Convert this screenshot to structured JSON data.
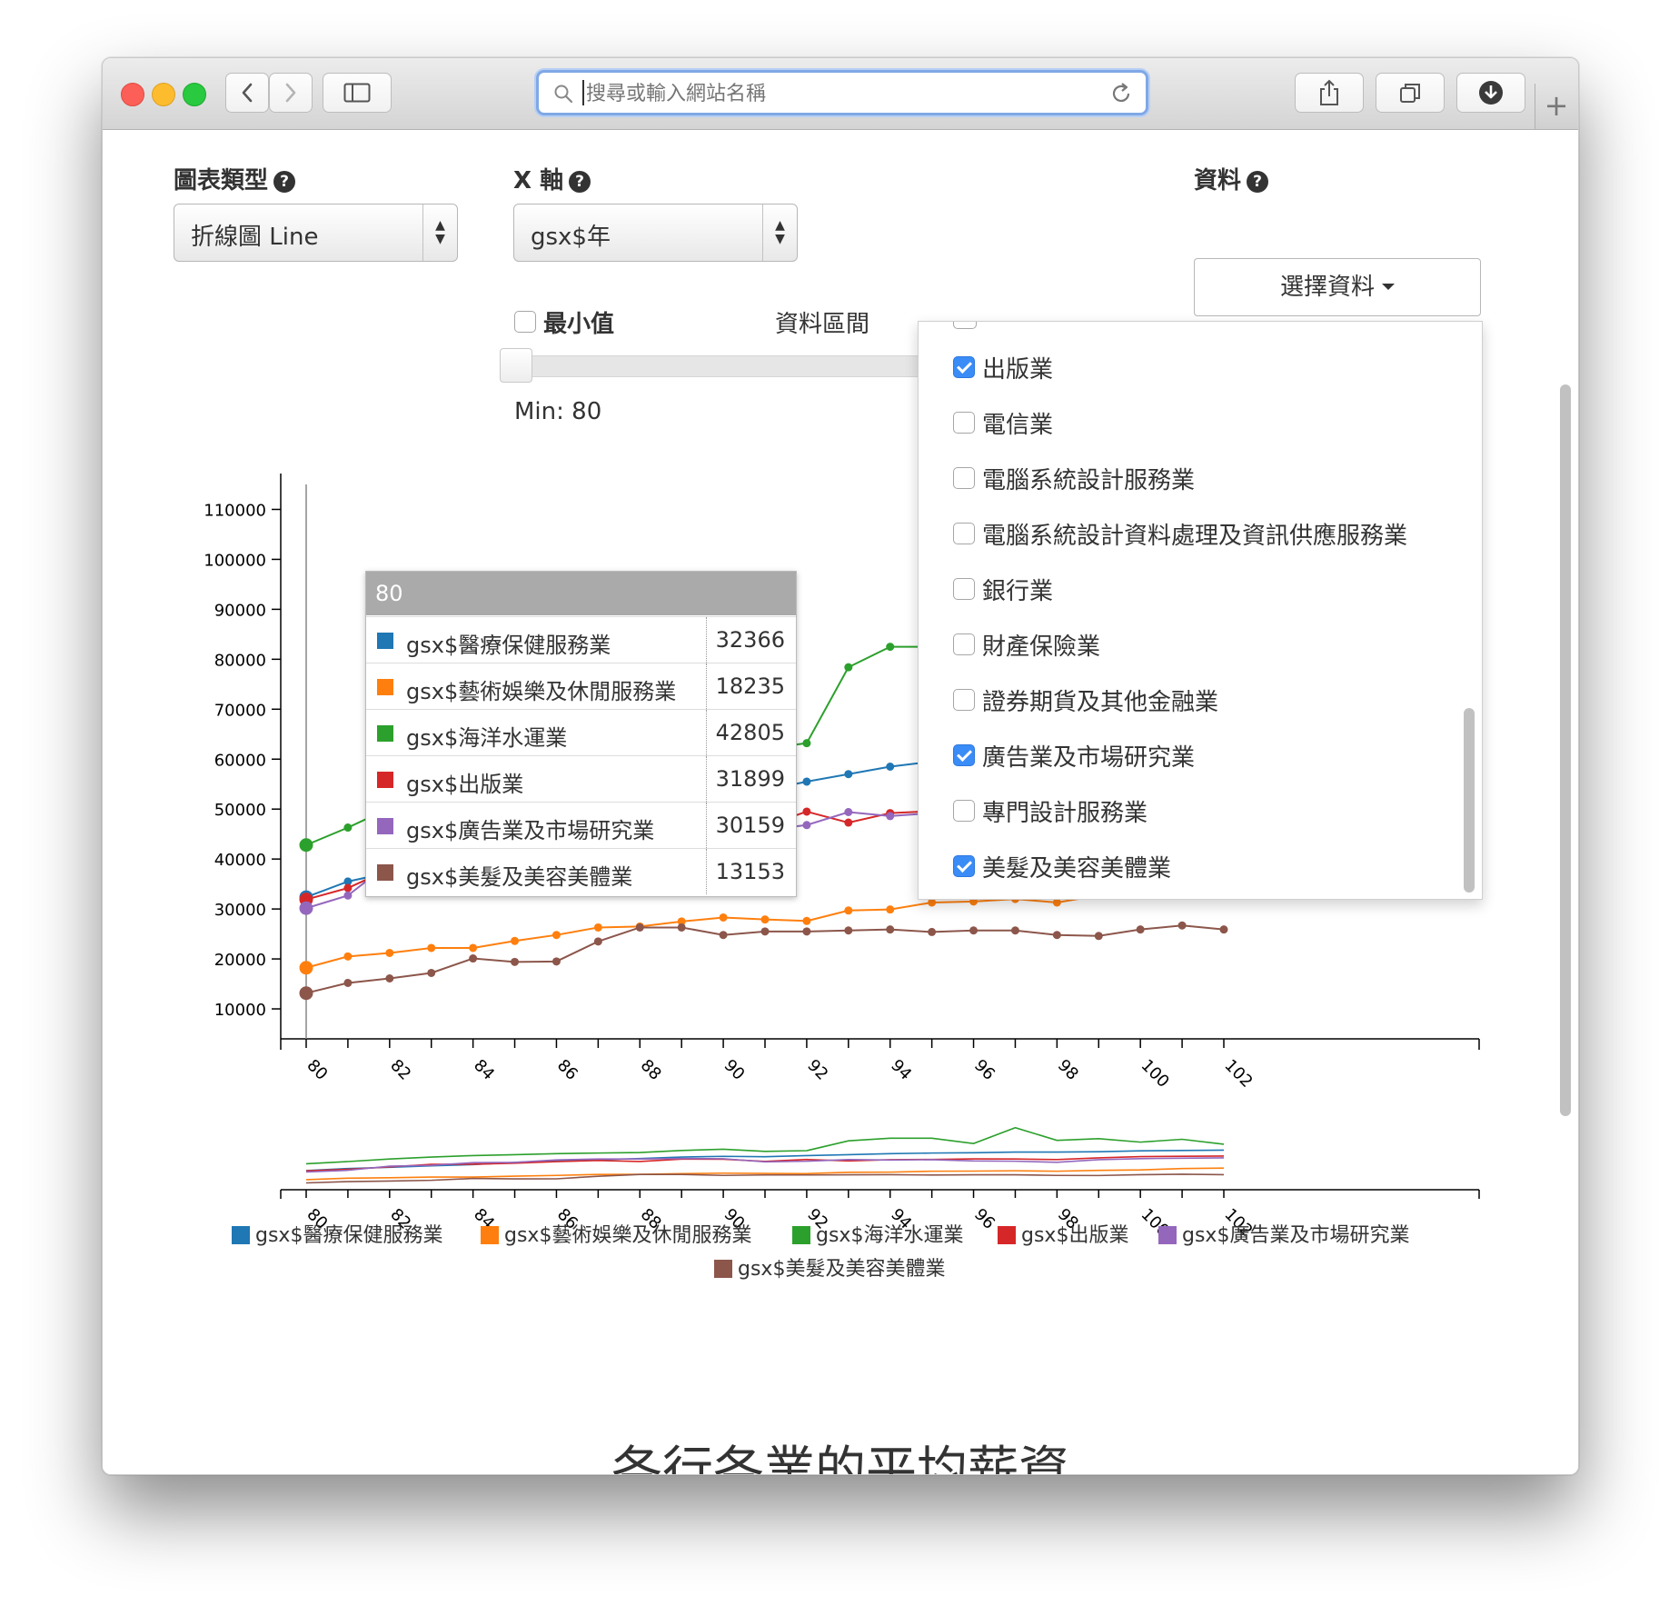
{
  "browser": {
    "address_placeholder": "搜尋或輸入網站名稱",
    "new_tab": "+"
  },
  "controls": {
    "chart_type_label": "圖表類型",
    "chart_type_value": "折線圖 Line",
    "x_axis_label": "X 軸",
    "x_axis_value": "gsx$年",
    "data_label": "資料",
    "data_button": "選擇資料",
    "help_glyph": "?",
    "min_label": "最小值",
    "range_label": "資料區間",
    "min_readout": "Min: 80",
    "select_up": "▲",
    "select_down": "▼"
  },
  "data_menu": {
    "items": [
      {
        "label": "出版業",
        "checked": true
      },
      {
        "label": "電信業",
        "checked": false
      },
      {
        "label": "電腦系統設計服務業",
        "checked": false
      },
      {
        "label": "電腦系統設計資料處理及資訊供應服務業",
        "checked": false
      },
      {
        "label": "銀行業",
        "checked": false
      },
      {
        "label": "財產保險業",
        "checked": false
      },
      {
        "label": "證券期貨及其他金融業",
        "checked": false
      },
      {
        "label": "廣告業及市場研究業",
        "checked": true
      },
      {
        "label": "專門設計服務業",
        "checked": false
      },
      {
        "label": "美髮及美容美體業",
        "checked": true
      }
    ]
  },
  "tooltip": {
    "header": "80",
    "rows": [
      {
        "name": "gsx$醫療保健服務業",
        "value": "32366",
        "color": "#1f77b4"
      },
      {
        "name": "gsx$藝術娛樂及休閒服務業",
        "value": "18235",
        "color": "#ff7f0e"
      },
      {
        "name": "gsx$海洋水運業",
        "value": "42805",
        "color": "#2ca02c"
      },
      {
        "name": "gsx$出版業",
        "value": "31899",
        "color": "#d62728"
      },
      {
        "name": "gsx$廣告業及市場研究業",
        "value": "30159",
        "color": "#9467bd"
      },
      {
        "name": "gsx$美髮及美容美體業",
        "value": "13153",
        "color": "#8c564b"
      }
    ]
  },
  "chart_title": "各行各業的平均薪資",
  "chart_data": {
    "type": "line",
    "title": "各行各業的平均薪資",
    "xlabel": "",
    "ylabel": "",
    "x": [
      80,
      81,
      82,
      83,
      84,
      85,
      86,
      87,
      88,
      89,
      90,
      91,
      92,
      93,
      94,
      95,
      96,
      97,
      98,
      99,
      100,
      101,
      102
    ],
    "x_ticks": [
      80,
      82,
      84,
      86,
      88,
      90,
      92,
      94,
      96,
      98,
      100,
      102
    ],
    "y_ticks": [
      10000,
      20000,
      30000,
      40000,
      50000,
      60000,
      70000,
      80000,
      90000,
      100000,
      110000
    ],
    "ylim": [
      4000,
      115000
    ],
    "grid": false,
    "legend_position": "bottom",
    "series": [
      {
        "name": "gsx$醫療保健服務業",
        "color": "#1f77b4",
        "values": [
          32366,
          35500,
          37300,
          39700,
          41600,
          44900,
          47400,
          49100,
          51000,
          53300,
          54400,
          53800,
          55500,
          57000,
          58500,
          59500,
          60000,
          61000,
          61000,
          61500,
          63000,
          63500,
          64000
        ]
      },
      {
        "name": "gsx$藝術娛樂及休閒服務業",
        "color": "#ff7f0e",
        "values": [
          18235,
          20500,
          21200,
          22200,
          22200,
          23600,
          24800,
          26300,
          26500,
          27500,
          28300,
          27900,
          27600,
          29700,
          29900,
          31300,
          31500,
          32000,
          31300,
          32700,
          33300,
          35400,
          36100
        ]
      },
      {
        "name": "gsx$海洋水運業",
        "color": "#2ca02c",
        "values": [
          42805,
          46300,
          50200,
          53300,
          55600,
          57000,
          58500,
          59500,
          60300,
          63500,
          65400,
          62100,
          63200,
          78400,
          82500,
          82500,
          74300,
          98800,
          79200,
          81800,
          76400,
          80800,
          73100
        ]
      },
      {
        "name": "gsx$出版業",
        "color": "#d62728",
        "values": [
          31899,
          34200,
          38000,
          42000,
          42200,
          43800,
          46100,
          48000,
          46400,
          50100,
          49900,
          46600,
          49500,
          47300,
          49200,
          49600,
          50400,
          50200,
          49400,
          52000,
          54000,
          54500,
          54800
        ]
      },
      {
        "name": "gsx$廣告業及市場研究業",
        "color": "#9467bd",
        "values": [
          30159,
          32700,
          39200,
          40400,
          44600,
          45000,
          48900,
          50300,
          50200,
          51000,
          50700,
          45800,
          46800,
          49400,
          48600,
          49200,
          47200,
          46800,
          45100,
          49200,
          50800,
          51500,
          52000
        ]
      },
      {
        "name": "gsx$美髮及美容美體業",
        "color": "#8c564b",
        "values": [
          13153,
          15200,
          16100,
          17200,
          20100,
          19400,
          19500,
          23500,
          26300,
          26300,
          24800,
          25500,
          25500,
          25700,
          25900,
          25400,
          25700,
          25700,
          24800,
          24600,
          25900,
          26700,
          25900
        ]
      }
    ]
  }
}
